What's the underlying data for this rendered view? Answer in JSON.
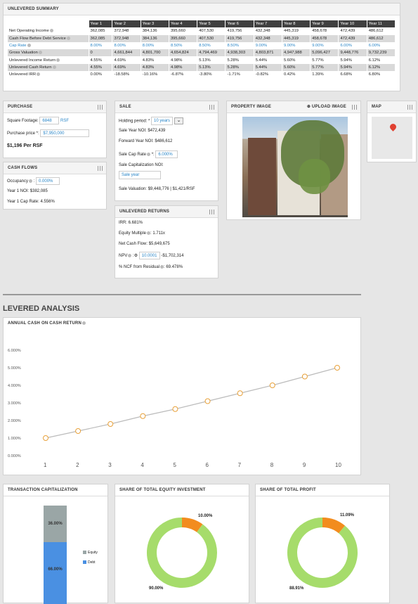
{
  "unlevered_summary": {
    "title": "UNLEVERED SUMMARY",
    "years": [
      "Year 1",
      "Year 2",
      "Year 3",
      "Year 4",
      "Year 5",
      "Year 6",
      "Year 7",
      "Year 8",
      "Year 9",
      "Year 10",
      "Year 11"
    ],
    "rows": [
      {
        "label": "Net Operating Income",
        "values": [
          "362,085",
          "372,948",
          "384,136",
          "395,660",
          "407,530",
          "419,756",
          "432,348",
          "445,319",
          "458,678",
          "472,439",
          "486,612"
        ],
        "style": "normal"
      },
      {
        "label": "Cash Flow Before Debt Service",
        "values": [
          "362,085",
          "372,948",
          "384,136",
          "395,660",
          "407,530",
          "419,756",
          "432,348",
          "445,319",
          "458,678",
          "472,439",
          "486,612"
        ],
        "style": "alt"
      },
      {
        "label": "Cap Rate",
        "values": [
          "8.00%",
          "8.00%",
          "8.00%",
          "8.50%",
          "8.50%",
          "8.50%",
          "9.00%",
          "9.00%",
          "9.00%",
          "6.00%",
          "6.00%"
        ],
        "style": "blue"
      },
      {
        "label": "Gross Valuation",
        "values": [
          "0",
          "4,661,844",
          "4,801,700",
          "4,654,824",
          "4,794,469",
          "4,938,303",
          "4,803,871",
          "4,947,988",
          "5,096,427",
          "9,448,776",
          "9,732,239"
        ],
        "style": "alt"
      },
      {
        "label": "Unlevered Income Return",
        "values": [
          "4.55%",
          "4.69%",
          "4.83%",
          "4.98%",
          "5.13%",
          "5.28%",
          "5.44%",
          "5.60%",
          "5.77%",
          "5.94%",
          "6.12%"
        ],
        "style": "normal"
      },
      {
        "label": "Unlevered Cash Return",
        "values": [
          "4.55%",
          "4.69%",
          "4.83%",
          "4.98%",
          "5.13%",
          "5.28%",
          "5.44%",
          "5.60%",
          "5.77%",
          "5.94%",
          "6.12%"
        ],
        "style": "alt"
      },
      {
        "label": "Unlevered IRR",
        "values": [
          "0.00%",
          "-18.58%",
          "-10.16%",
          "-6.87%",
          "-3.80%",
          "-1.71%",
          "-0.82%",
          "0.42%",
          "1.39%",
          "6.68%",
          "6.80%"
        ],
        "style": "normal"
      }
    ]
  },
  "purchase": {
    "title": "PURCHASE",
    "sqft_label": "Square Footage:",
    "sqft_value": "6848",
    "sqft_unit": "RSF",
    "price_label": "Purchase price *:",
    "price_value": "$7,950,000",
    "per_rsf": "$1,196 Per RSF"
  },
  "cash_flows": {
    "title": "CASH FLOWS",
    "occupancy_label": "Occupancy",
    "occupancy_value": "0.000%",
    "noi": "Year 1 NOI: $382,085",
    "cap_rate": "Year 1 Cap Rate: 4.556%"
  },
  "sale": {
    "title": "SALE",
    "holding_label": "Holding period: *",
    "holding_value": "10 years",
    "sale_year_noi": "Sale Year NOI: $472,439",
    "forward_noi": "Forward Year NOI: $486,612",
    "cap_label": "Sale Cap Rate",
    "cap_value": "6.000%",
    "cap_noi_label": "Sale Capitalization NOI:",
    "cap_noi_value": "Sale year",
    "valuation": "Sale Valuation: $9,448,776 | $1,421/RSF"
  },
  "unlevered_returns": {
    "title": "UNLEVERED RETURNS",
    "irr": "IRR: 6.681%",
    "equity_multiple": "Equity Multiple",
    "equity_multiple_value": ": 1.711x",
    "net_cash_flow": "Net Cash Flow: $5,649,675",
    "npv_label": "NPV",
    "npv_rate": "10.0001",
    "npv_value": "-$1,702,314",
    "ncf_residual": "% NCF from Residual",
    "ncf_residual_value": ": 69.478%"
  },
  "property_image": {
    "title": "PROPERTY IMAGE",
    "upload": "Upload Image"
  },
  "map": {
    "title": "MAP"
  },
  "levered": {
    "title": "LEVERED ANALYSIS",
    "chart_title": "ANNUAL CASH ON CASH RETURN"
  },
  "chart_data": {
    "type": "line",
    "x": [
      1,
      2,
      3,
      4,
      5,
      6,
      7,
      8,
      9,
      10
    ],
    "y_ticks": [
      "0.000%",
      "1.000%",
      "2.000%",
      "3.000%",
      "4.000%",
      "5.000%",
      "6.000%"
    ],
    "y_ticks_extra": "",
    "values": [
      1.0,
      1.4,
      1.8,
      2.25,
      2.65,
      3.1,
      3.55,
      4.0,
      4.5,
      5.0
    ],
    "ylim": [
      0,
      6
    ],
    "line_color": "#bbbbbb",
    "marker_color": "#e8a13a"
  },
  "transaction_cap": {
    "title": "TRANSACTION CAPITALIZATION",
    "equity_pct": "36.00%",
    "debt_pct": "66.00%",
    "equity_label": "Equity",
    "debt_label": "Debt",
    "equity_color": "#9aa6a6",
    "debt_color": "#4a90e2"
  },
  "share_equity": {
    "title": "SHARE OF TOTAL EQUITY INVESTMENT",
    "small_pct": "10.00%",
    "large_pct": "90.00%",
    "small_value": 10,
    "large_value": 90
  },
  "share_profit": {
    "title": "SHARE OF TOTAL PROFIT",
    "small_pct": "11.09%",
    "large_pct": "88.91%",
    "small_value": 11.09,
    "large_value": 88.91
  },
  "donut_colors": {
    "large": "#a6dc6b",
    "small": "#f28c1e"
  }
}
